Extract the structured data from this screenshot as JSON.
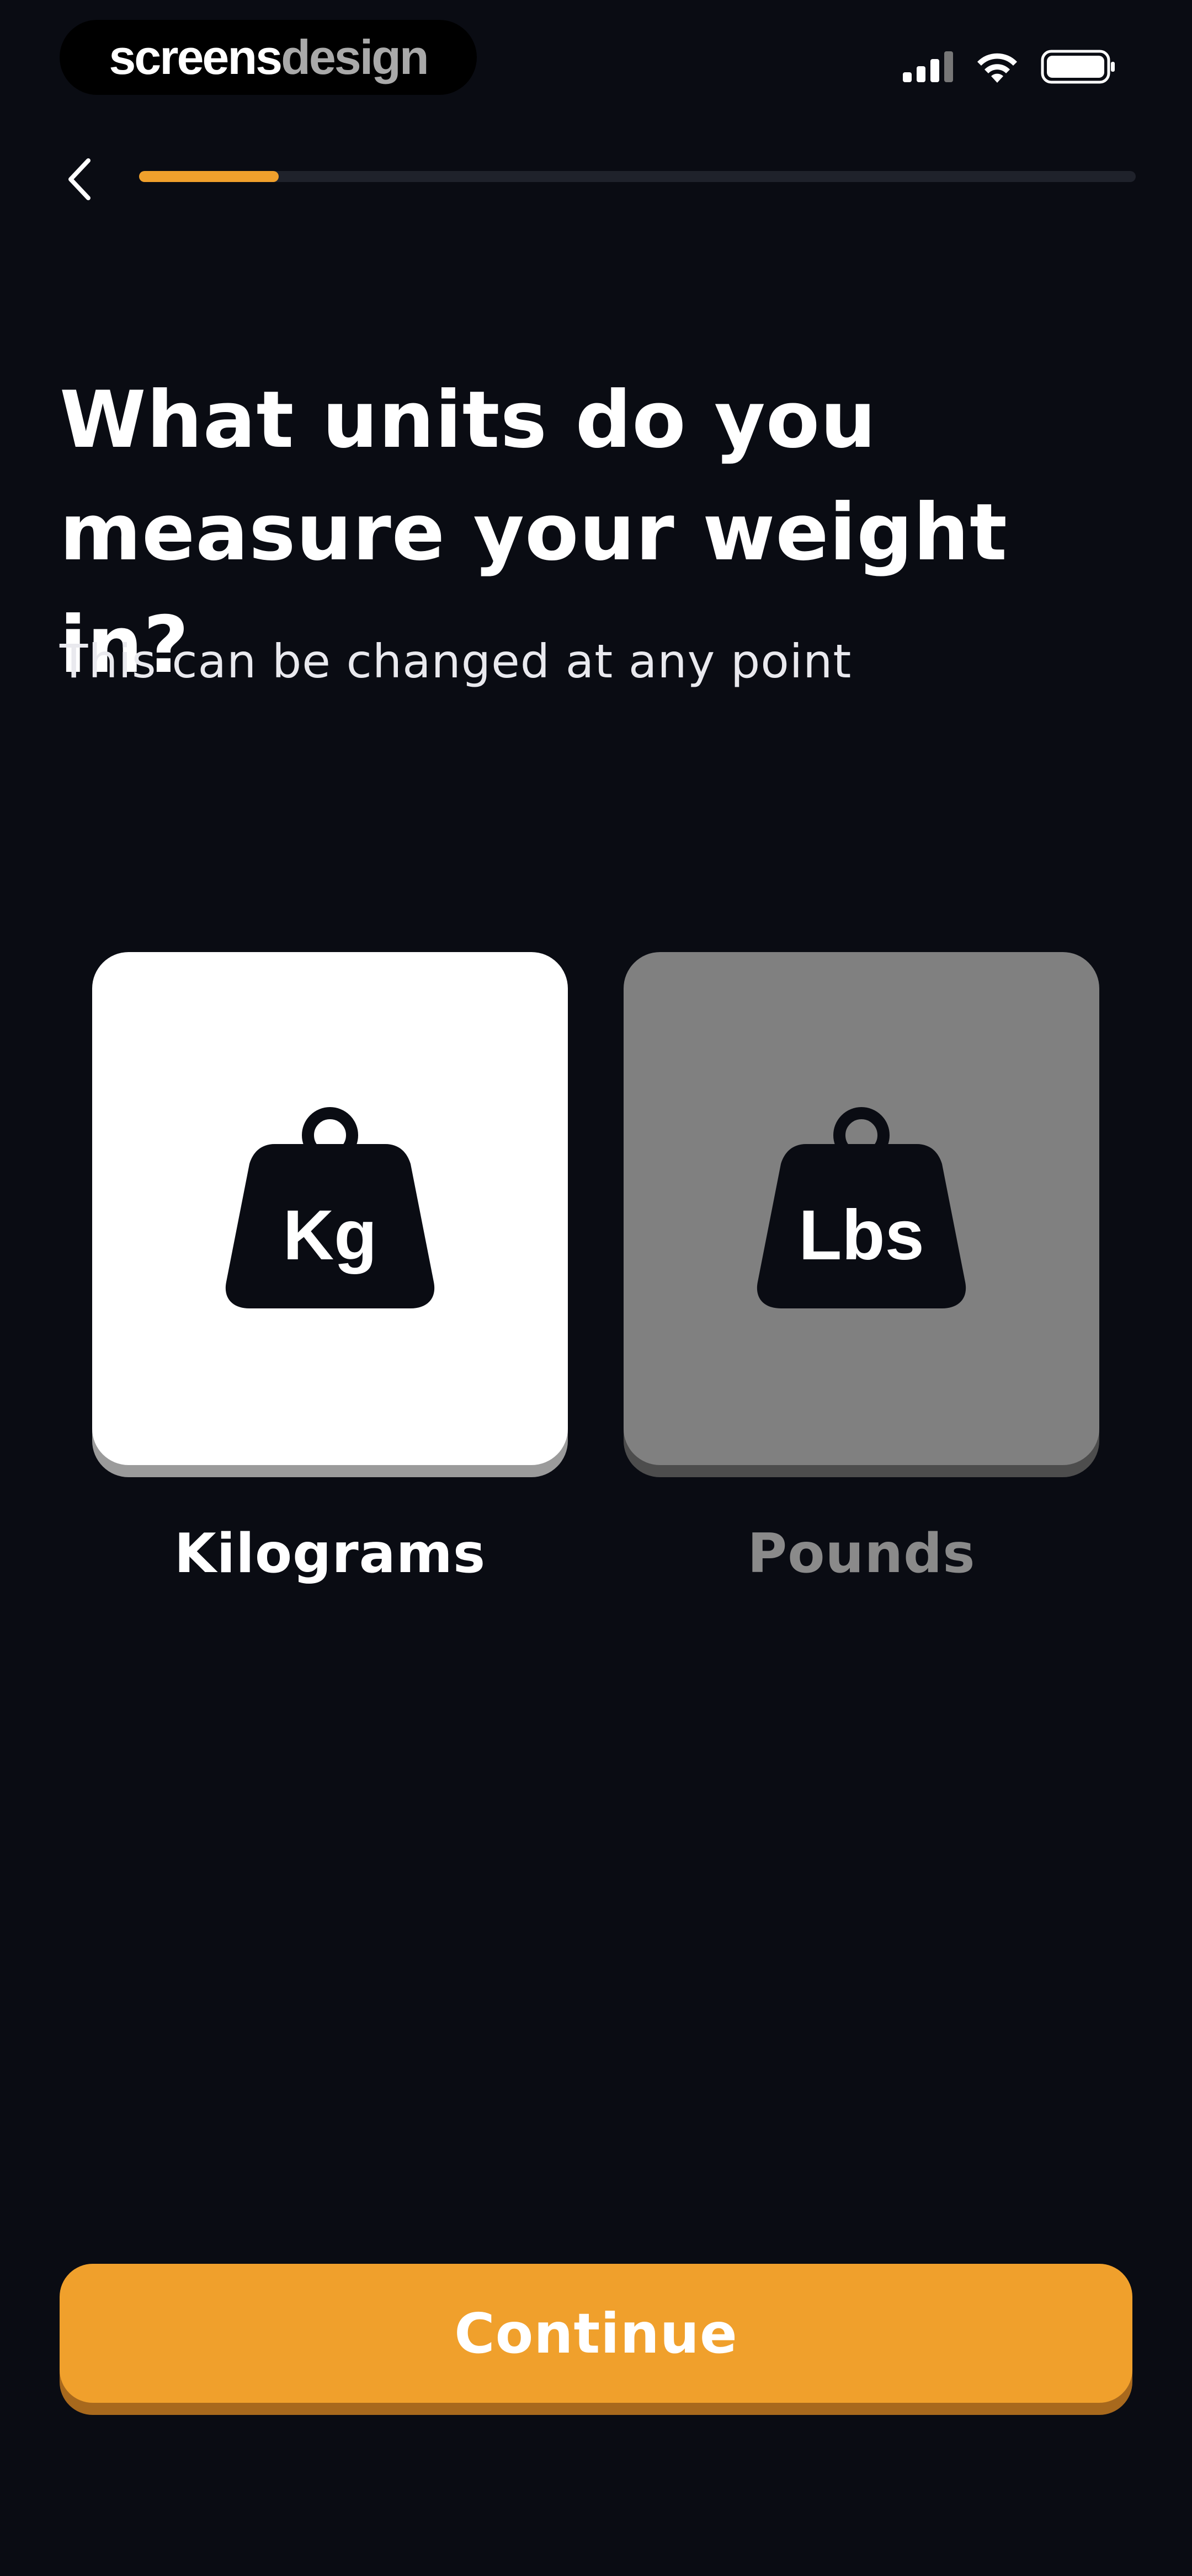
{
  "status_bar": {
    "brand_part1": "screens",
    "brand_part2": "design",
    "icons": [
      "cellular-signal-icon",
      "wifi-icon",
      "battery-icon"
    ]
  },
  "nav": {
    "back_icon": "chevron-left-icon",
    "progress": 0.14
  },
  "header": {
    "title": "What units do you measure your weight in?",
    "subtitle": "This can be changed at any point"
  },
  "options": [
    {
      "icon_text": "Kg",
      "label": "Kilograms",
      "selected": true
    },
    {
      "icon_text": "Lbs",
      "label": "Pounds",
      "selected": false
    }
  ],
  "footer": {
    "continue_label": "Continue"
  },
  "colors": {
    "accent": "#f0a02c",
    "background": "#0a0c13",
    "selected_card": "#ffffff",
    "unselected_card": "#808080"
  }
}
